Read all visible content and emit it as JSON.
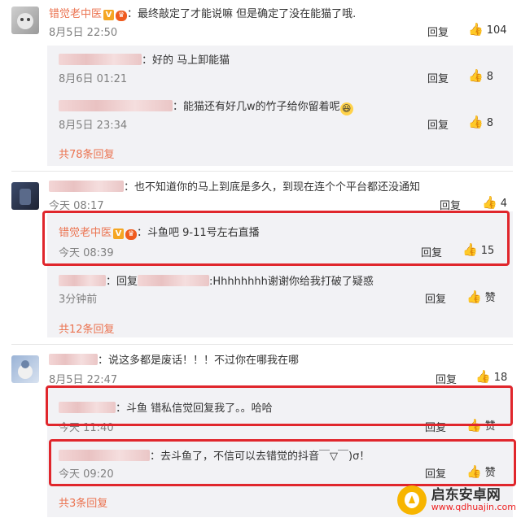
{
  "comment1": {
    "user": "错觉老中医",
    "text": "：最终敲定了才能说嘛 但是确定了没在能猫了哦.",
    "time": "8月5日 22:50",
    "reply_label": "回复",
    "likes": "104",
    "replies": [
      {
        "text": "：好的 马上卸能猫",
        "time": "8月6日 01:21",
        "reply_label": "回复",
        "likes": "8"
      },
      {
        "text": "：能猫还有好几w的竹子给你留着呢",
        "time": "8月5日 23:34",
        "reply_label": "回复",
        "likes": "8"
      }
    ],
    "more": "共78条回复"
  },
  "comment2": {
    "text": "：也不知道你的马上到底是多久，到现在连个个平台都还没通知",
    "time": "今天 08:17",
    "reply_label": "回复",
    "likes": "4",
    "replies": [
      {
        "user": "错觉老中医",
        "text": "：斗鱼吧 9-11号左右直播",
        "time": "今天 08:39",
        "reply_label": "回复",
        "likes": "15"
      },
      {
        "prefix": "：回复",
        "text": ":Hhhhhhhh谢谢你给我打破了疑惑",
        "time": "3分钟前",
        "reply_label": "回复",
        "likes": "赞"
      }
    ],
    "more": "共12条回复"
  },
  "comment3": {
    "text": "：说这多都是废话！！！不过你在哪我在哪",
    "time": "8月5日 22:47",
    "reply_label": "回复",
    "likes": "18",
    "replies": [
      {
        "text": "：斗鱼  错私信觉回复我了。。哈哈",
        "time": "今天 11:40",
        "reply_label": "回复",
        "likes": "赞"
      },
      {
        "text": "：去斗鱼了，不信可以去错觉的抖音￣▽￣)σ！",
        "time": "今天 09:20",
        "reply_label": "回复",
        "likes": "赞"
      }
    ],
    "more": "共3条回复"
  },
  "watermark": {
    "title": "启东安卓网",
    "sub": "www.qdhuajin.com"
  },
  "colors": {
    "accent": "#eb7350",
    "highlight_box": "#e0262c",
    "panel": "#f2f2f5"
  }
}
